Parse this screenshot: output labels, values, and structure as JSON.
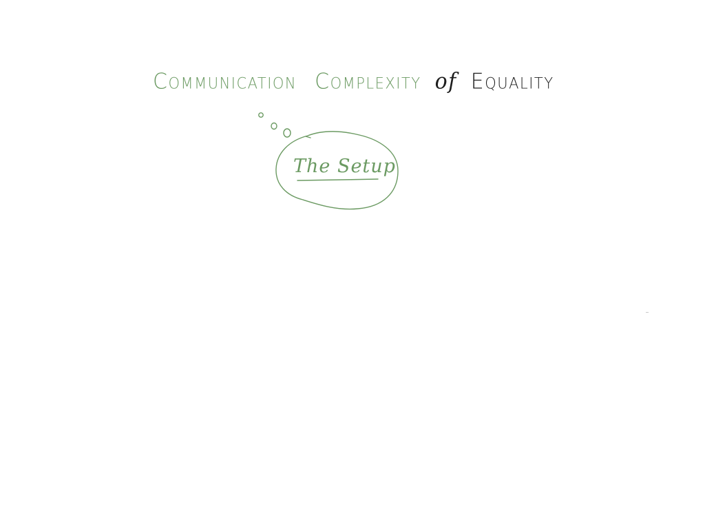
{
  "slide": {
    "title_words": [
      "Communication",
      "Complexity",
      "of",
      "Equality"
    ],
    "bubble_label": "The Setup"
  },
  "colors": {
    "ink_green": "#6b9a62",
    "ink_black": "#1e1e1e",
    "background": "#ffffff"
  }
}
